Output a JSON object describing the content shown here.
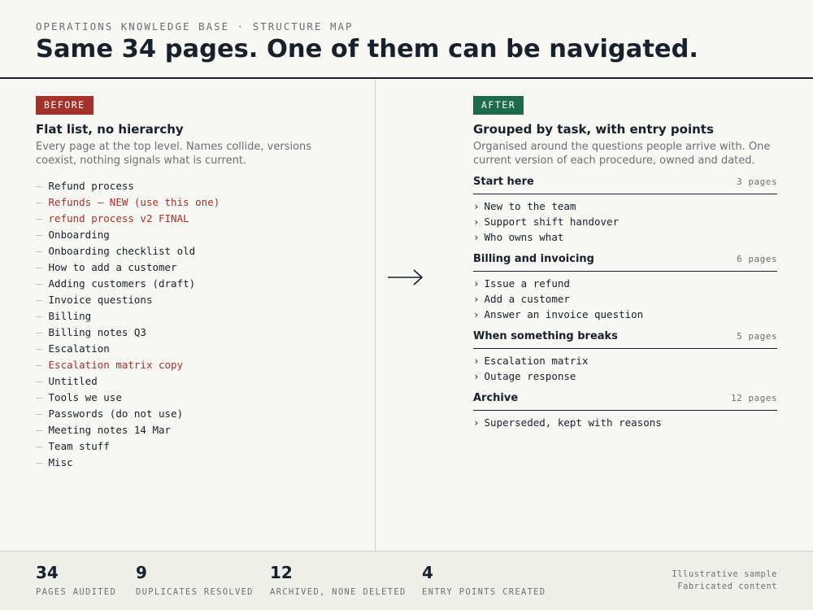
{
  "header": {
    "kicker": "OPERATIONS KNOWLEDGE BASE · STRUCTURE MAP",
    "headline": "Same 34 pages. One of them can be navigated."
  },
  "before": {
    "badge": "BEFORE",
    "title": "Flat list, no hierarchy",
    "description": "Every page at the top level. Names collide, versions coexist, nothing signals what is current.",
    "items": [
      {
        "label": "Refund process",
        "flag": false
      },
      {
        "label": "Refunds — NEW (use this one)",
        "flag": true
      },
      {
        "label": "refund process v2 FINAL",
        "flag": true
      },
      {
        "label": "Onboarding",
        "flag": false
      },
      {
        "label": "Onboarding checklist old",
        "flag": false
      },
      {
        "label": "How to add a customer",
        "flag": false
      },
      {
        "label": "Adding customers (draft)",
        "flag": false
      },
      {
        "label": "Invoice questions",
        "flag": false
      },
      {
        "label": "Billing",
        "flag": false
      },
      {
        "label": "Billing notes Q3",
        "flag": false
      },
      {
        "label": "Escalation",
        "flag": false
      },
      {
        "label": "Escalation matrix copy",
        "flag": true
      },
      {
        "label": "Untitled",
        "flag": false
      },
      {
        "label": "Tools we use",
        "flag": false
      },
      {
        "label": "Passwords (do not use)",
        "flag": false
      },
      {
        "label": "Meeting notes 14 Mar",
        "flag": false
      },
      {
        "label": "Team stuff",
        "flag": false
      },
      {
        "label": "Misc",
        "flag": false
      }
    ]
  },
  "after": {
    "badge": "AFTER",
    "title": "Grouped by task, with entry points",
    "description": "Organised around the questions people arrive with. One current version of each procedure, owned and dated.",
    "groups": [
      {
        "name": "Start here",
        "count": "3 pages",
        "items": [
          "New to the team",
          "Support shift handover",
          "Who owns what"
        ]
      },
      {
        "name": "Billing and invoicing",
        "count": "6 pages",
        "items": [
          "Issue a refund",
          "Add a customer",
          "Answer an invoice question"
        ]
      },
      {
        "name": "When something breaks",
        "count": "5 pages",
        "items": [
          "Escalation matrix",
          "Outage response"
        ]
      },
      {
        "name": "Archive",
        "count": "12 pages",
        "items": [
          "Superseded, kept with reasons"
        ]
      }
    ]
  },
  "stats": [
    {
      "value": "34",
      "label": "PAGES AUDITED"
    },
    {
      "value": "9",
      "label": "DUPLICATES RESOLVED"
    },
    {
      "value": "12",
      "label": "ARCHIVED, NONE DELETED"
    },
    {
      "value": "4",
      "label": "ENTRY POINTS CREATED"
    }
  ],
  "note": {
    "line1": "Illustrative sample",
    "line2": "Fabricated content"
  },
  "colors": {
    "ink": "#17202b",
    "before_accent": "#a5322a",
    "after_accent": "#1e6a4c",
    "muted": "#6b6f75"
  },
  "icons": {
    "arrow": "right-arrow-icon",
    "chevron": "chevron-right-icon",
    "dash": "em-dash-bullet"
  }
}
